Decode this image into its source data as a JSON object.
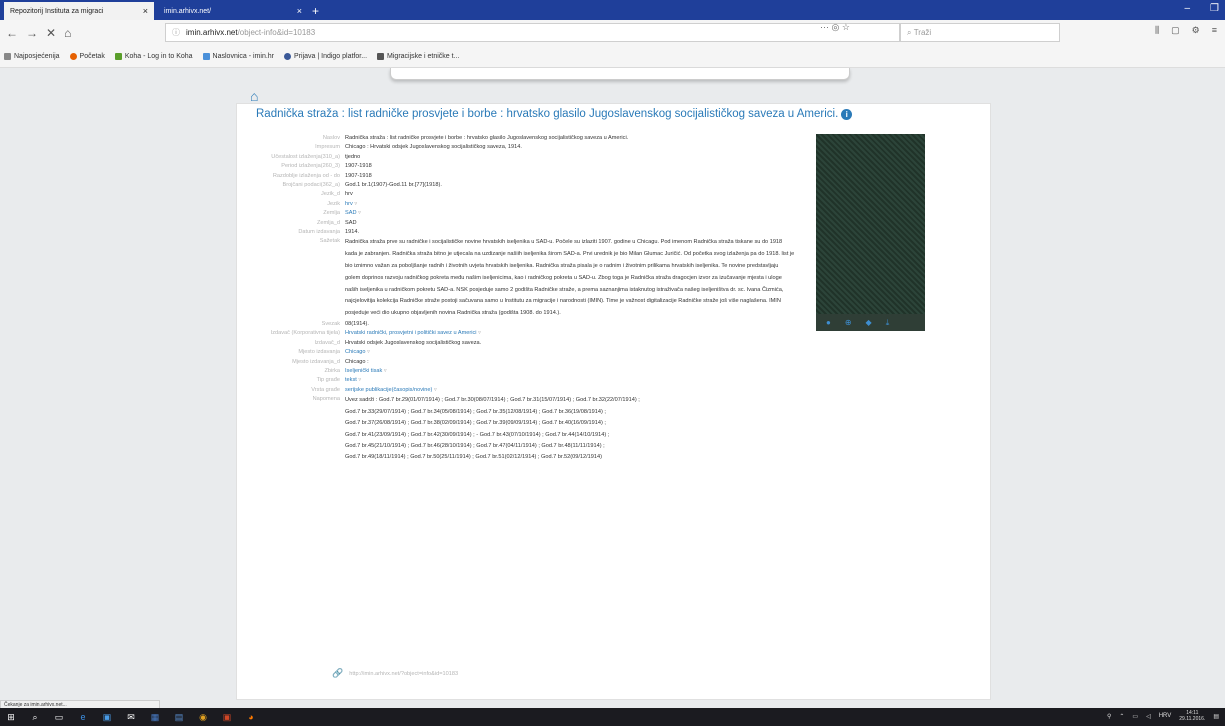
{
  "browser": {
    "tabs": [
      {
        "label": "Repozitorij Instituta za migraci",
        "active": true
      },
      {
        "label": "imin.arhivx.net/",
        "active": false
      }
    ],
    "url_prefix": "imin.arhivx.net",
    "url_path": "/object-info&id=10183",
    "search_placeholder": "Traži",
    "bookmarks": [
      "Najposjećenija",
      "Početak",
      "Koha - Log in to Koha",
      "Naslovnica - imin.hr",
      "Prijava | Indigo platfor...",
      "Migracijske i etničke t..."
    ],
    "status_text": "Čekanje za imin.arhivx.net..."
  },
  "record": {
    "title": "Radnička straža : list radničke prosvjete i borbe : hrvatsko glasilo Jugoslavenskog socijalističkog saveza u Americi.",
    "fields": [
      {
        "label": "Naslov",
        "value": "Radnička straža : list radničke prosvjete i borbe : hrvatsko glasilo Jugoslavenskog socijalističkog saveza u Americi."
      },
      {
        "label": "Impresum",
        "value": "Chicago : Hrvatski odsjek Jugoslavenskog socijalističkog saveza, 1914."
      },
      {
        "label": "Učestalost izlaženja(310_a)",
        "value": "tjedno"
      },
      {
        "label": "Period izlaženja(260_3)",
        "value": "1907-1918"
      },
      {
        "label": "Razdoblje izlaženja od - do",
        "value": "1907-1918"
      },
      {
        "label": "Brojčani podaci(362_a)",
        "value": "God.1 br.1(1907)-God.11 br.[77](1918)."
      },
      {
        "label": "Jezik_d",
        "value": "hrv"
      },
      {
        "label": "Jezik",
        "value": "hrv",
        "link": true
      },
      {
        "label": "Zemlja",
        "value": "SAD",
        "link": true
      },
      {
        "label": "Zemlja_d",
        "value": "SAD"
      },
      {
        "label": "Datum izdavanja",
        "value": "1914."
      }
    ],
    "summary_label": "Sažetak",
    "summary": "Radnička straža prve su radničke i socijalističke novine hrvatskih iseljenika u SAD-u. Počele su izlaziti 1907. godine u Chicagu. Pod imenom Radnička straža tiskane su do 1918 kada je zabranjen. Radnička straža bitno je utjecala na uzdizanje našiih iseljenika širom SAD-a. Prvi urednik je bio Milan Glumac Juričić. Od početka svog izlaženja pa do 1918. list je bio iznimno važan za poboljšanje radnih i životnih uvjeta hrvatskih iseljenika. Radnička straža pisala je o radnim i životnim prilikama hrvatskih iseljenika. Te novine predstavljaju golem doprinos razvoju radničkog pokreta među našim iseljenicima, kao i radničkog pokreta u SAD-u. Zbog toga je Radnička straža dragocjen izvor za izučavanje mjesta i uloge naših iseljenika u radničkom pokretu SAD-a. NSK posjeduje samo 2 godišta Radničke straže, a prema saznanjima istaknutog istraživača našeg iseljeništva dr. sc. Ivana Čizmića, najcjelovitija kolekcija Radničke straže postoji sačuvana samo u Institutu za migracije i narodnosti (IMIN). Time je važnost digitalizacije Radničke straže još više naglašena. IMIN posjeduje veći dio ukupno objavljenih novina Radnička straža (godišta 1908. do 1914.).",
    "fields2": [
      {
        "label": "Svezak",
        "value": "08(1914)."
      },
      {
        "label": "Izdavač (Korporativna tijela)",
        "value": "Hrvatski radnički, prosvjetni i politički savez u Americi",
        "link": true
      },
      {
        "label": "Izdavač_d",
        "value": "Hrvatski odsjek Jugoslavenskog socijalističkog saveza."
      },
      {
        "label": "Mjesto izdavanja",
        "value": "Chicago",
        "link": true
      },
      {
        "label": "Mjesto izdavanja_d",
        "value": "Chicago :"
      },
      {
        "label": "Zbirka",
        "value": "Iseljenički tisak",
        "link": true
      },
      {
        "label": "Tip građe",
        "value": "tekst",
        "link": true
      },
      {
        "label": "Vrsta građe",
        "value": "serijske publikacije(časopis/novine)",
        "link": true
      }
    ],
    "notes_label": "Napomena",
    "notes": [
      "Uvez sadrži : God.7 br.29(01/07/1914) ; God.7 br.30(08/07/1914) ; God.7 br.31(15/07/1914) ; God.7 br.32(22/07/1914) ;",
      "God.7 br.33(29/07/1914) ; God.7 br.34(05/08/1914) ; God.7 br.35(12/08/1914) ; God.7 br.36(19/08/1914) ;",
      "God.7 br.37(26/08/1914) ; God.7 br.38(02/09/1914) ; God.7 br.39(09/09/1914) ; God.7 br.40(16/09/1914) ;",
      "God.7 br.41(23/09/1914) ; God.7 br.42(30/09/1914) ; - God.7 br.43(07/10/1914) ; God.7 br.44(14/10/1914) ;",
      "God.7 br.45(21/10/1914) ; God.7 br.46(28/10/1914) ; God.7 br.47(04/11/1914) ; God.7 br.48(11/11/1914) ;",
      "God.7 br.49(18/11/1914) ; God.7 br.50(25/11/1914) ; God.7 br.51(02/12/1914) ; God.7 br.52(09/12/1914)"
    ],
    "permalink": "http://imin.arhivx.net/?object=info&id=10183"
  },
  "taskbar": {
    "tray_lang": "HRV",
    "time": "14:11",
    "date": "29.11.2016."
  }
}
